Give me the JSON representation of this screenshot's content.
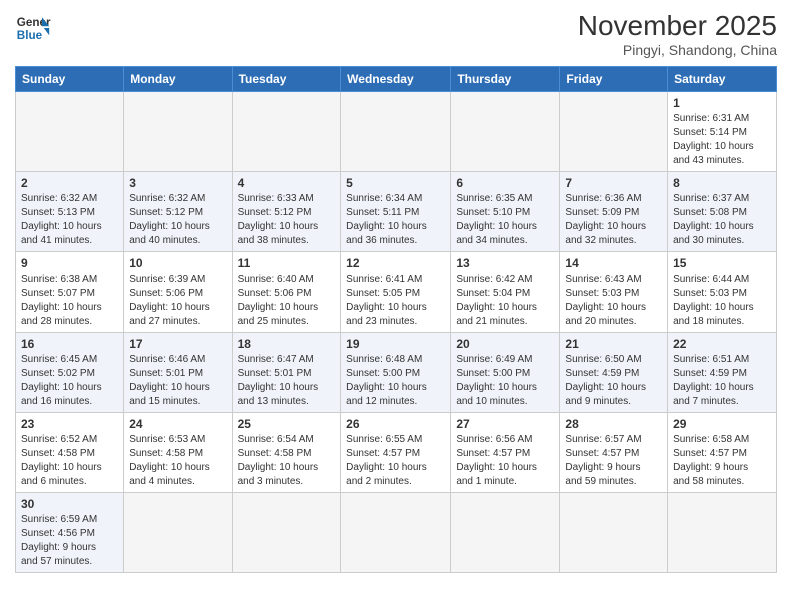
{
  "logo": {
    "text_general": "General",
    "text_blue": "Blue"
  },
  "header": {
    "month_year": "November 2025",
    "location": "Pingyi, Shandong, China"
  },
  "weekdays": [
    "Sunday",
    "Monday",
    "Tuesday",
    "Wednesday",
    "Thursday",
    "Friday",
    "Saturday"
  ],
  "weeks": [
    [
      {
        "day": "",
        "info": ""
      },
      {
        "day": "",
        "info": ""
      },
      {
        "day": "",
        "info": ""
      },
      {
        "day": "",
        "info": ""
      },
      {
        "day": "",
        "info": ""
      },
      {
        "day": "",
        "info": ""
      },
      {
        "day": "1",
        "info": "Sunrise: 6:31 AM\nSunset: 5:14 PM\nDaylight: 10 hours\nand 43 minutes."
      }
    ],
    [
      {
        "day": "2",
        "info": "Sunrise: 6:32 AM\nSunset: 5:13 PM\nDaylight: 10 hours\nand 41 minutes."
      },
      {
        "day": "3",
        "info": "Sunrise: 6:32 AM\nSunset: 5:12 PM\nDaylight: 10 hours\nand 40 minutes."
      },
      {
        "day": "4",
        "info": "Sunrise: 6:33 AM\nSunset: 5:12 PM\nDaylight: 10 hours\nand 38 minutes."
      },
      {
        "day": "5",
        "info": "Sunrise: 6:34 AM\nSunset: 5:11 PM\nDaylight: 10 hours\nand 36 minutes."
      },
      {
        "day": "6",
        "info": "Sunrise: 6:35 AM\nSunset: 5:10 PM\nDaylight: 10 hours\nand 34 minutes."
      },
      {
        "day": "7",
        "info": "Sunrise: 6:36 AM\nSunset: 5:09 PM\nDaylight: 10 hours\nand 32 minutes."
      },
      {
        "day": "8",
        "info": "Sunrise: 6:37 AM\nSunset: 5:08 PM\nDaylight: 10 hours\nand 30 minutes."
      }
    ],
    [
      {
        "day": "9",
        "info": "Sunrise: 6:38 AM\nSunset: 5:07 PM\nDaylight: 10 hours\nand 28 minutes."
      },
      {
        "day": "10",
        "info": "Sunrise: 6:39 AM\nSunset: 5:06 PM\nDaylight: 10 hours\nand 27 minutes."
      },
      {
        "day": "11",
        "info": "Sunrise: 6:40 AM\nSunset: 5:06 PM\nDaylight: 10 hours\nand 25 minutes."
      },
      {
        "day": "12",
        "info": "Sunrise: 6:41 AM\nSunset: 5:05 PM\nDaylight: 10 hours\nand 23 minutes."
      },
      {
        "day": "13",
        "info": "Sunrise: 6:42 AM\nSunset: 5:04 PM\nDaylight: 10 hours\nand 21 minutes."
      },
      {
        "day": "14",
        "info": "Sunrise: 6:43 AM\nSunset: 5:03 PM\nDaylight: 10 hours\nand 20 minutes."
      },
      {
        "day": "15",
        "info": "Sunrise: 6:44 AM\nSunset: 5:03 PM\nDaylight: 10 hours\nand 18 minutes."
      }
    ],
    [
      {
        "day": "16",
        "info": "Sunrise: 6:45 AM\nSunset: 5:02 PM\nDaylight: 10 hours\nand 16 minutes."
      },
      {
        "day": "17",
        "info": "Sunrise: 6:46 AM\nSunset: 5:01 PM\nDaylight: 10 hours\nand 15 minutes."
      },
      {
        "day": "18",
        "info": "Sunrise: 6:47 AM\nSunset: 5:01 PM\nDaylight: 10 hours\nand 13 minutes."
      },
      {
        "day": "19",
        "info": "Sunrise: 6:48 AM\nSunset: 5:00 PM\nDaylight: 10 hours\nand 12 minutes."
      },
      {
        "day": "20",
        "info": "Sunrise: 6:49 AM\nSunset: 5:00 PM\nDaylight: 10 hours\nand 10 minutes."
      },
      {
        "day": "21",
        "info": "Sunrise: 6:50 AM\nSunset: 4:59 PM\nDaylight: 10 hours\nand 9 minutes."
      },
      {
        "day": "22",
        "info": "Sunrise: 6:51 AM\nSunset: 4:59 PM\nDaylight: 10 hours\nand 7 minutes."
      }
    ],
    [
      {
        "day": "23",
        "info": "Sunrise: 6:52 AM\nSunset: 4:58 PM\nDaylight: 10 hours\nand 6 minutes."
      },
      {
        "day": "24",
        "info": "Sunrise: 6:53 AM\nSunset: 4:58 PM\nDaylight: 10 hours\nand 4 minutes."
      },
      {
        "day": "25",
        "info": "Sunrise: 6:54 AM\nSunset: 4:58 PM\nDaylight: 10 hours\nand 3 minutes."
      },
      {
        "day": "26",
        "info": "Sunrise: 6:55 AM\nSunset: 4:57 PM\nDaylight: 10 hours\nand 2 minutes."
      },
      {
        "day": "27",
        "info": "Sunrise: 6:56 AM\nSunset: 4:57 PM\nDaylight: 10 hours\nand 1 minute."
      },
      {
        "day": "28",
        "info": "Sunrise: 6:57 AM\nSunset: 4:57 PM\nDaylight: 9 hours\nand 59 minutes."
      },
      {
        "day": "29",
        "info": "Sunrise: 6:58 AM\nSunset: 4:57 PM\nDaylight: 9 hours\nand 58 minutes."
      }
    ],
    [
      {
        "day": "30",
        "info": "Sunrise: 6:59 AM\nSunset: 4:56 PM\nDaylight: 9 hours\nand 57 minutes."
      },
      {
        "day": "",
        "info": ""
      },
      {
        "day": "",
        "info": ""
      },
      {
        "day": "",
        "info": ""
      },
      {
        "day": "",
        "info": ""
      },
      {
        "day": "",
        "info": ""
      },
      {
        "day": "",
        "info": ""
      }
    ]
  ]
}
